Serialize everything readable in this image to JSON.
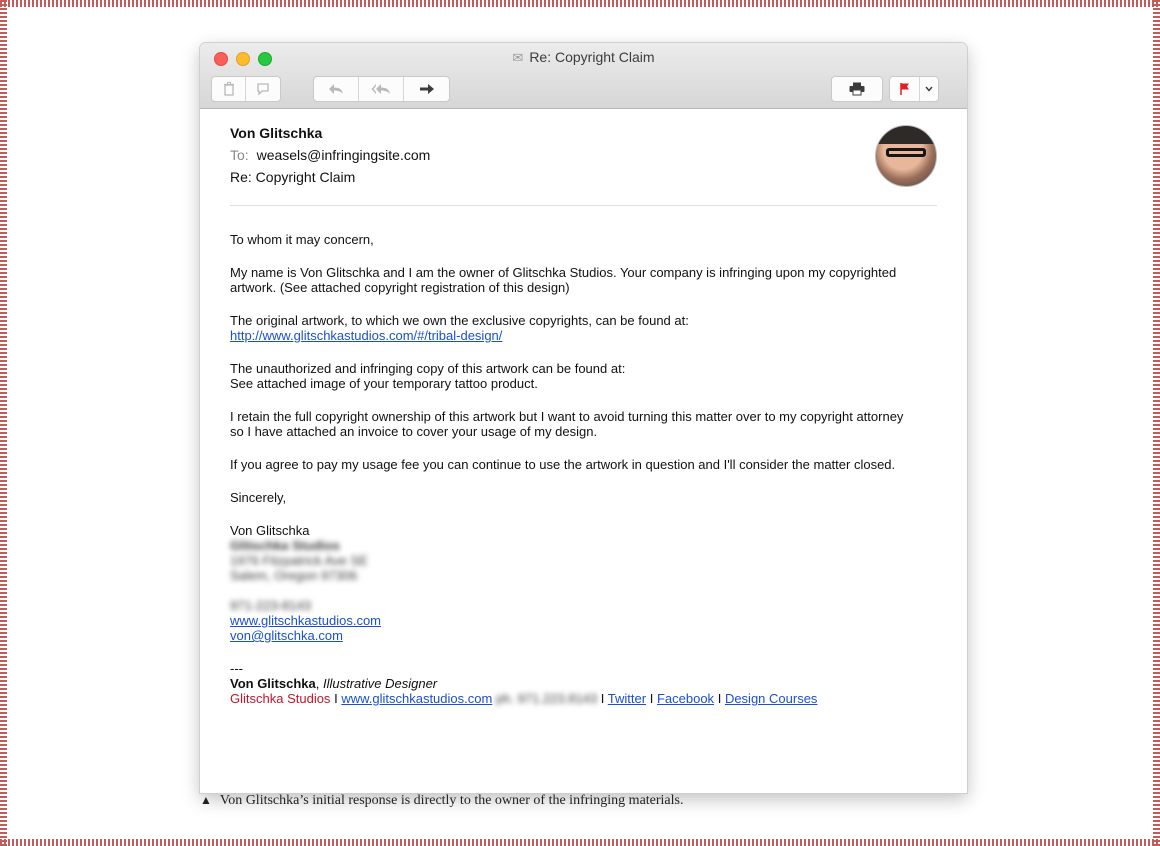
{
  "window": {
    "title": "Re: Copyright Claim",
    "icons": [
      "trash-icon",
      "junk-icon",
      "reply-icon",
      "reply-all-icon",
      "forward-icon",
      "print-icon",
      "flag-icon",
      "chevron-down-icon",
      "envelope-icon"
    ]
  },
  "header": {
    "from": "Von Glitschka",
    "to_label": "To:",
    "to": "weasels@infringingsite.com",
    "subject": "Re: Copyright Claim"
  },
  "body": {
    "greeting": "To whom it may concern,",
    "p1": "My name is Von Glitschka and I am the owner of Glitschka Studios. Your company is infringing upon my copyrighted artwork. (See attached copyright registration of this design)",
    "p2": "The original artwork, to which we own the exclusive copyrights, can be found at:",
    "p2_link": "http://www.glitschkastudios.com/#/tribal-design/",
    "p3a": "The unauthorized and infringing copy of this artwork can be found at:",
    "p3b": "See attached image of your temporary tattoo product.",
    "p4": "I retain the full copyright ownership of this artwork but I want to avoid turning this matter over to my copyright attorney so I have attached an invoice to cover your usage of my design.",
    "p5": "If you agree to pay my usage fee you can continue to use the artwork in question and I'll consider the matter closed.",
    "closing": "Sincerely,"
  },
  "signature": {
    "name": "Von Glitschka",
    "studio_blurred": "Glitschka Studios",
    "address1_blurred": "1976 Fitzpatrick Ave SE",
    "address2_blurred": "Salem, Oregon 97306",
    "phone_blurred": "971-223-8143",
    "website": "www.glitschkastudios.com",
    "email": "von@glitschka.com",
    "dashes": "---",
    "name_bold": "Von Glitschka",
    "title_sep": ",",
    "title": "Illustrative Designer",
    "studio": "Glitschka Studios",
    "sep": "I",
    "footer_site": "www.glitschkastudios.com",
    "footer_phone_blurred": "ph. 971.223.8143",
    "twitter": "Twitter",
    "facebook": "Facebook",
    "courses": "Design Courses"
  },
  "caption": {
    "marker": "▲",
    "text": "Von Glitschka’s initial response is directly to the owner of the infringing materials."
  }
}
